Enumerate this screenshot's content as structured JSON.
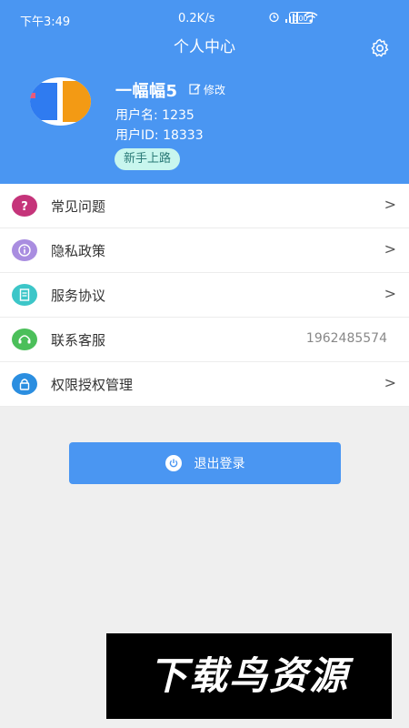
{
  "status_bar": {
    "time": "下午3:49",
    "network_speed": "0.2K/s",
    "battery": "100"
  },
  "header": {
    "title": "个人中心",
    "settings_icon": "gear-icon"
  },
  "profile": {
    "nickname": "一幅幅5",
    "edit_label": "修改",
    "username_line": "用户名: 1235",
    "user_id_line": "用户ID: 18333",
    "badge": "新手上路"
  },
  "menu": {
    "items": [
      {
        "label": "常见问题",
        "icon": "question-icon",
        "color": "#c5347a",
        "value": "",
        "arrow": ">"
      },
      {
        "label": "隐私政策",
        "icon": "info-icon",
        "color": "#a98de0",
        "value": "",
        "arrow": ">"
      },
      {
        "label": "服务协议",
        "icon": "document-icon",
        "color": "#3cc6c8",
        "value": "",
        "arrow": ">"
      },
      {
        "label": "联系客服",
        "icon": "headset-icon",
        "color": "#4bbf5a",
        "value": "1962485574",
        "arrow": ""
      },
      {
        "label": "权限授权管理",
        "icon": "lock-icon",
        "color": "#2b8ee0",
        "value": "",
        "arrow": ">"
      }
    ]
  },
  "logout": {
    "label": "退出登录",
    "icon": "power-icon"
  },
  "watermark": {
    "text": "下载鸟资源"
  },
  "colors": {
    "primary": "#4a96f2",
    "badge_bg": "#c8f6ee",
    "page_bg": "#efefef"
  }
}
